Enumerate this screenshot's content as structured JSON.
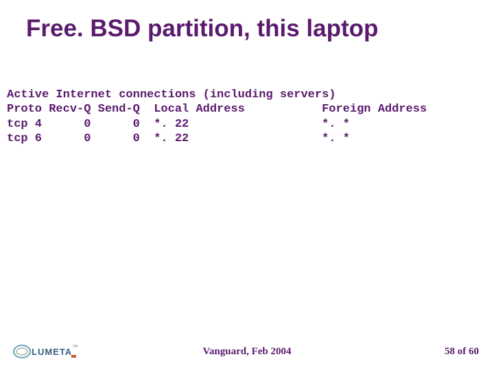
{
  "title": "Free. BSD partition, this laptop",
  "netstat": {
    "header": "Active Internet connections (including servers)",
    "columns": "Proto Recv-Q Send-Q  Local Address           Foreign Address",
    "rows": [
      "tcp 4      0      0  *. 22                   *. *",
      "tcp 6      0      0  *. 22                   *. *"
    ]
  },
  "footer": {
    "center": "Vanguard, Feb 2004",
    "page": "58 of  60"
  },
  "logo": {
    "name": "LUMETA"
  }
}
